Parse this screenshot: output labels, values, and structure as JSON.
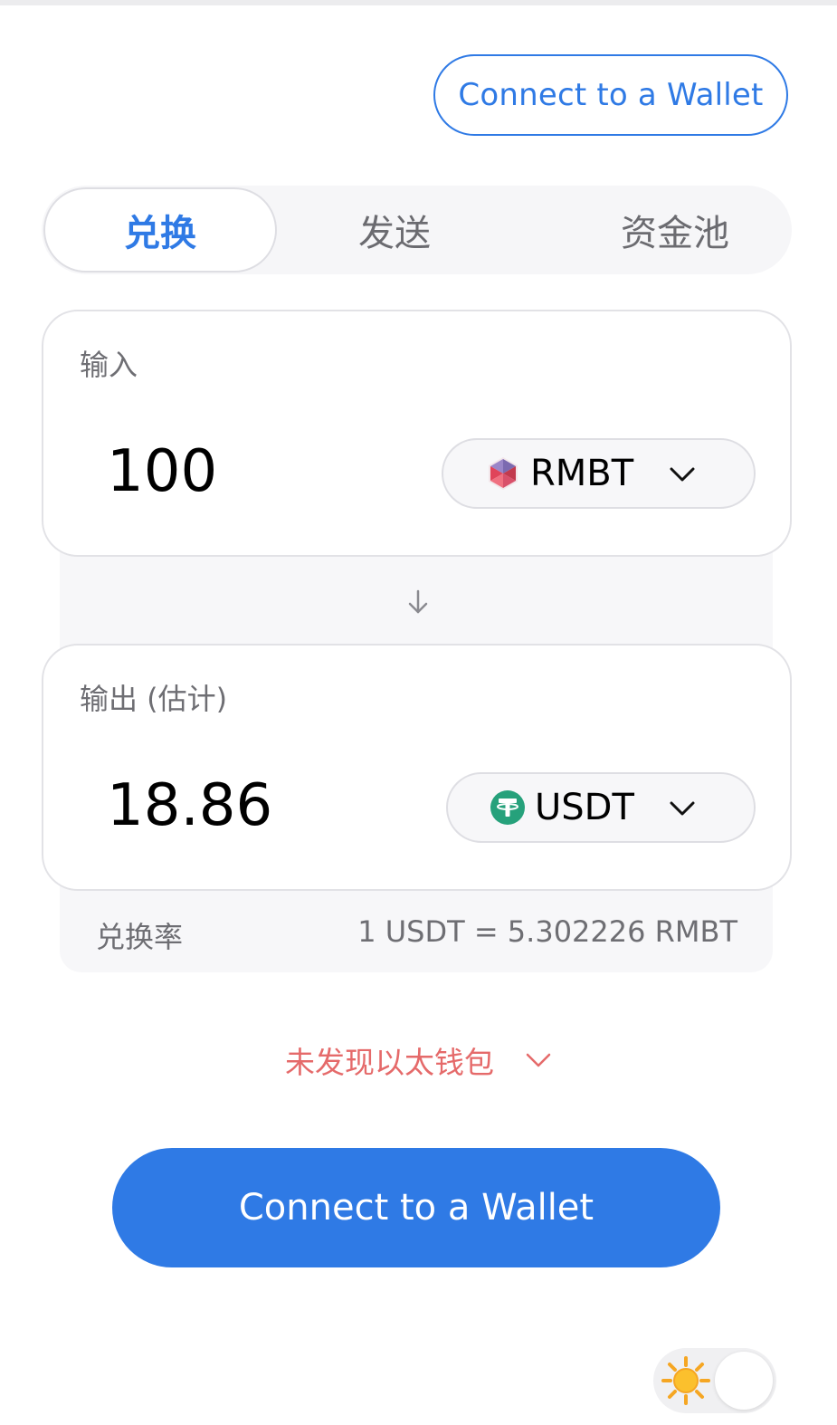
{
  "header": {
    "connect_label": "Connect to a Wallet"
  },
  "tabs": [
    {
      "label": "兑换",
      "active": true
    },
    {
      "label": "发送",
      "active": false
    },
    {
      "label": "资金池",
      "active": false
    }
  ],
  "input_card": {
    "label": "输入",
    "amount": "100",
    "token": {
      "symbol": "RMBT",
      "icon": "rmbt-token-icon"
    }
  },
  "output_card": {
    "label": "输出 (估计)",
    "amount": "18.86",
    "token": {
      "symbol": "USDT",
      "icon": "usdt-token-icon"
    }
  },
  "rate": {
    "label": "兑换率",
    "value": "1 USDT = 5.302226 RMBT"
  },
  "warning": {
    "text": "未发现以太钱包"
  },
  "main_button": {
    "label": "Connect to a Wallet"
  },
  "theme": {
    "mode": "light",
    "icon": "sun-icon"
  },
  "colors": {
    "accent": "#2f7ae5",
    "warning": "#e56a6a",
    "muted": "#6e6e73"
  }
}
